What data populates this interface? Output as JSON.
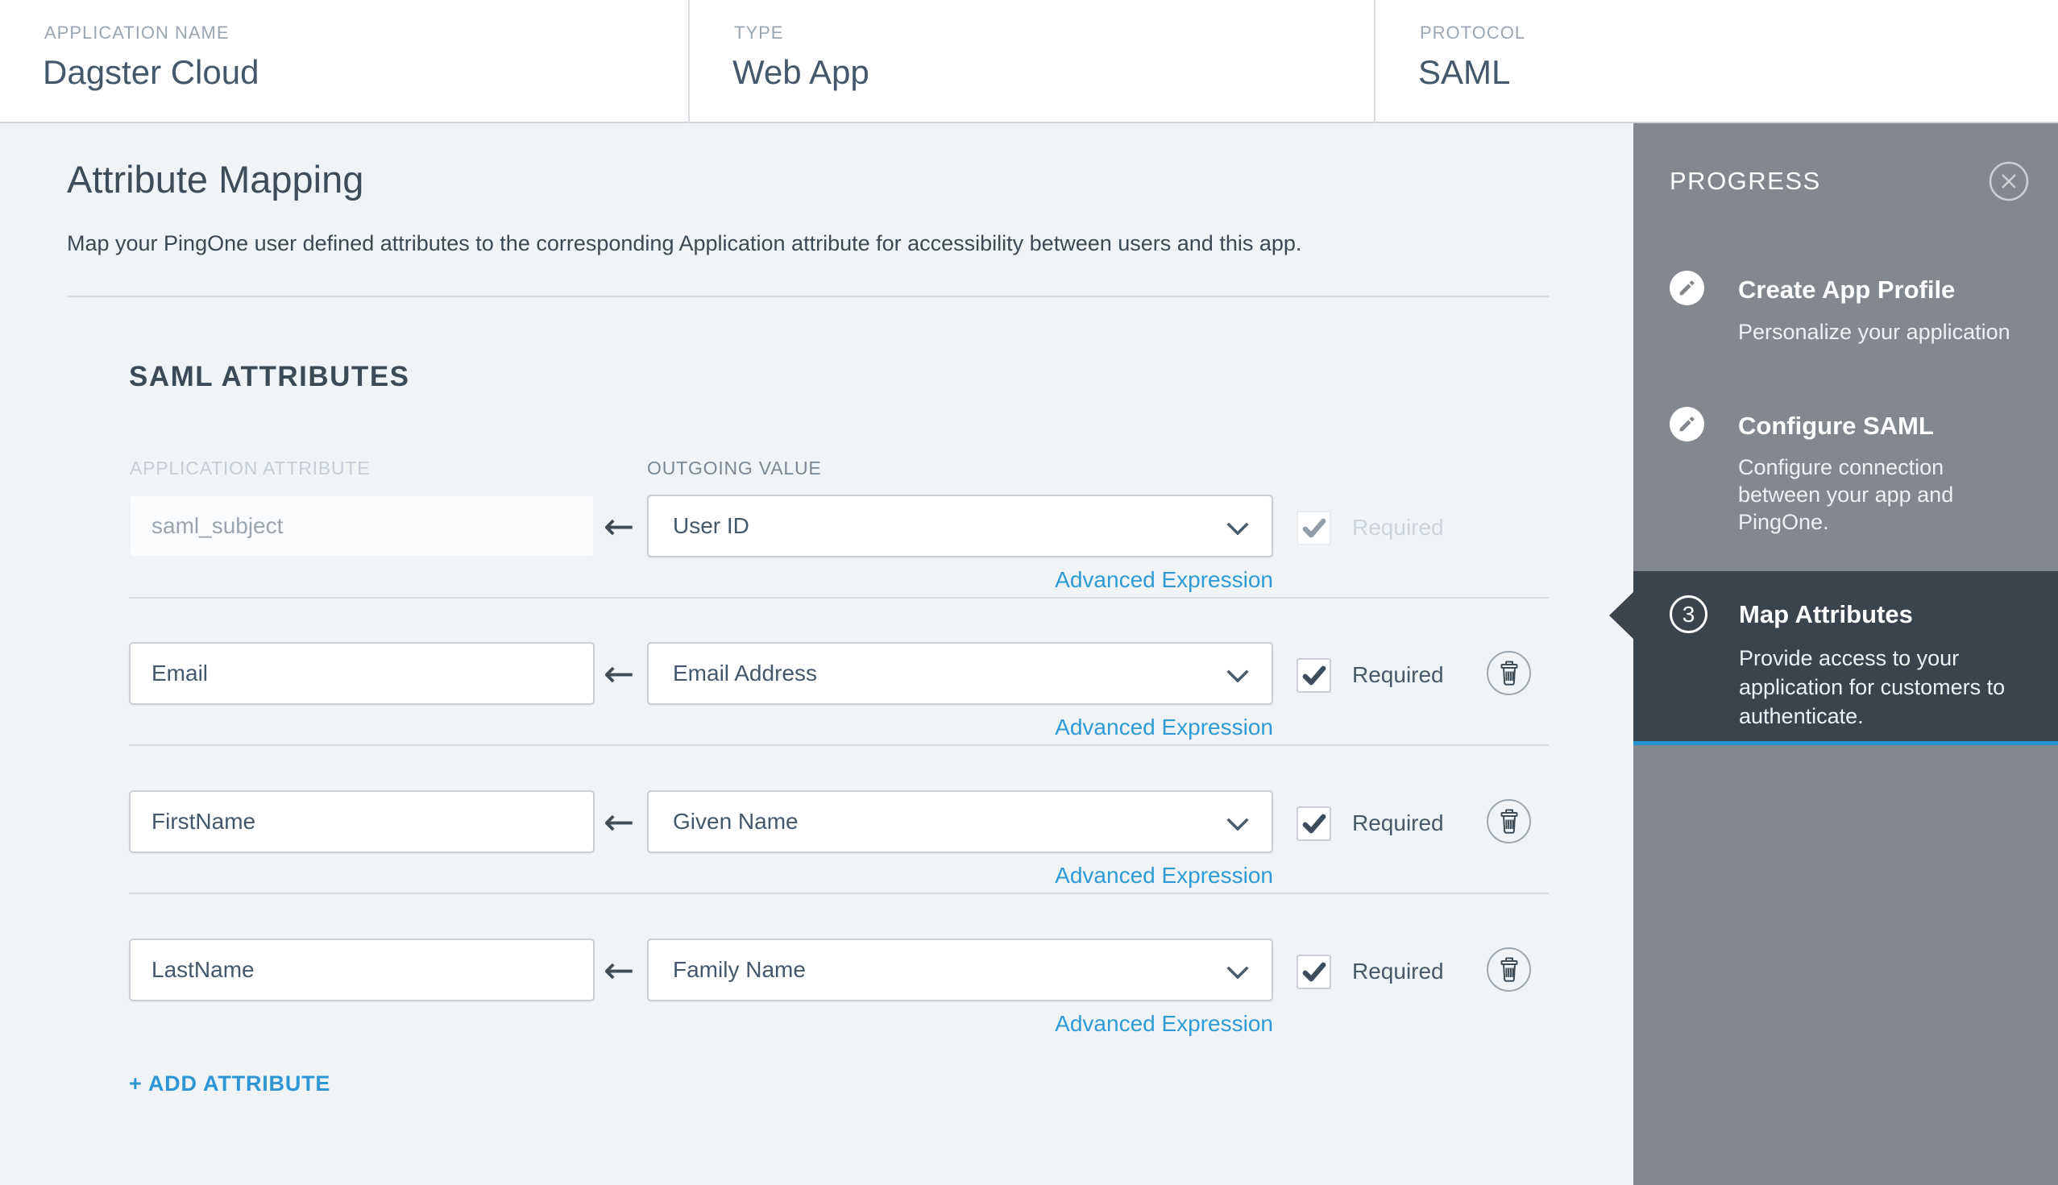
{
  "header": {
    "fields": [
      {
        "label": "APPLICATION NAME",
        "value": "Dagster Cloud"
      },
      {
        "label": "TYPE",
        "value": "Web App"
      },
      {
        "label": "PROTOCOL",
        "value": "SAML"
      }
    ]
  },
  "main": {
    "title": "Attribute Mapping",
    "description": "Map your PingOne user defined attributes to the corresponding Application attribute for accessibility between users and this app.",
    "section_heading": "SAML ATTRIBUTES",
    "column_headers": {
      "application_attribute": "APPLICATION ATTRIBUTE",
      "outgoing_value": "OUTGOING VALUE"
    },
    "labels": {
      "required": "Required",
      "advanced_expression": "Advanced Expression",
      "add_attribute": "+ ADD ATTRIBUTE",
      "map_arrow": "←"
    },
    "rows": [
      {
        "application_attribute": "saml_subject",
        "outgoing_value": "User ID",
        "required_checked": true,
        "disabled": true,
        "deletable": false
      },
      {
        "application_attribute": "Email",
        "outgoing_value": "Email Address",
        "required_checked": true,
        "disabled": false,
        "deletable": true
      },
      {
        "application_attribute": "FirstName",
        "outgoing_value": "Given Name",
        "required_checked": true,
        "disabled": false,
        "deletable": true
      },
      {
        "application_attribute": "LastName",
        "outgoing_value": "Family Name",
        "required_checked": true,
        "disabled": false,
        "deletable": true
      }
    ]
  },
  "progress_panel": {
    "title": "PROGRESS",
    "icons": {
      "close": "circle-x",
      "completed_step": "pencil",
      "chevron": "chevron-down",
      "check": "checkmark",
      "trash": "trash-can"
    },
    "steps": [
      {
        "title": "Create App Profile",
        "description": "Personalize your application",
        "icon": "pencil",
        "active": false
      },
      {
        "title": "Configure SAML",
        "description": "Configure connection between your app and PingOne.",
        "icon": "pencil",
        "active": false
      },
      {
        "number": "3",
        "title": "Map Attributes",
        "description": "Provide access to your application for customers to authenticate.",
        "icon": "number",
        "active": true
      }
    ]
  },
  "colors": {
    "page_bg": "#f0f4f7",
    "accent_blue": "#2f9bd6",
    "active_step_underline": "#2196d3",
    "progress_bg": "#83888e",
    "active_step_bg": "#3b444d",
    "text_dark": "#44576b"
  }
}
